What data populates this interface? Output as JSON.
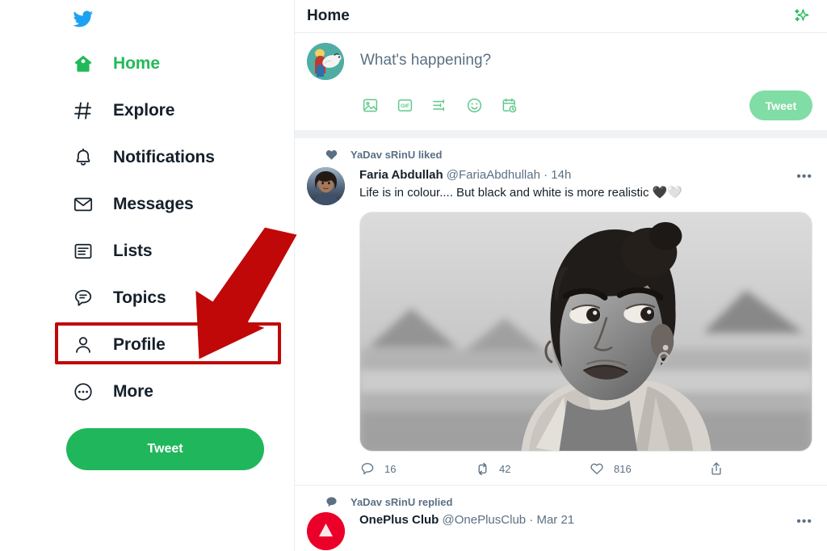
{
  "sidebar": {
    "logo_icon": "twitter-bird-icon",
    "items": [
      {
        "label": "Home",
        "icon": "home-icon",
        "active": true
      },
      {
        "label": "Explore",
        "icon": "hashtag-icon",
        "active": false
      },
      {
        "label": "Notifications",
        "icon": "bell-icon",
        "active": false
      },
      {
        "label": "Messages",
        "icon": "envelope-icon",
        "active": false
      },
      {
        "label": "Lists",
        "icon": "list-icon",
        "active": false
      },
      {
        "label": "Topics",
        "icon": "speech-bubble-icon",
        "active": false
      },
      {
        "label": "Profile",
        "icon": "person-icon",
        "active": false
      },
      {
        "label": "More",
        "icon": "more-circle-icon",
        "active": false
      }
    ],
    "tweet_button": "Tweet"
  },
  "annotation": {
    "highlight_target": "Profile",
    "arrow_icon": "red-arrow-icon",
    "color": "#c00808"
  },
  "header": {
    "title": "Home",
    "sparkle_icon": "sparkle-icon"
  },
  "compose": {
    "avatar_icon": "user-avatar",
    "placeholder": "What's happening?",
    "tools": [
      {
        "icon": "image-icon",
        "label": "Media"
      },
      {
        "icon": "gif-icon",
        "label": "GIF"
      },
      {
        "icon": "poll-icon",
        "label": "Poll"
      },
      {
        "icon": "emoji-icon",
        "label": "Emoji"
      },
      {
        "icon": "schedule-icon",
        "label": "Schedule"
      }
    ],
    "tweet_button": "Tweet"
  },
  "timeline": [
    {
      "context_icon": "heart-filled-icon",
      "context_text": "YaDav sRinU liked",
      "author_name": "Faria Abdullah",
      "author_handle": "@FariaAbdhullah",
      "separator": "·",
      "timestamp": "14h",
      "more_icon": "more-horizontal-icon",
      "text": "Life is in colour.... But black and white is more realistic 🖤🤍",
      "media_icon": "photo-black-and-white",
      "actions": {
        "reply_icon": "reply-icon",
        "reply_count": "16",
        "retweet_icon": "retweet-icon",
        "retweet_count": "42",
        "like_icon": "heart-outline-icon",
        "like_count": "816",
        "share_icon": "share-icon"
      }
    },
    {
      "context_icon": "speech-bubble-filled-icon",
      "context_text": "YaDav sRinU replied",
      "author_name": "OnePlus Club",
      "author_handle": "@OnePlusClub",
      "separator": "·",
      "timestamp": "Mar 21",
      "more_icon": "more-horizontal-icon"
    }
  ],
  "colors": {
    "brand_blue": "#1da1f2",
    "accent_green": "#20b75c",
    "accent_green_muted": "#80dda5",
    "text_primary": "#15202b",
    "text_secondary": "#5b7083",
    "annotation_red": "#c00808"
  }
}
